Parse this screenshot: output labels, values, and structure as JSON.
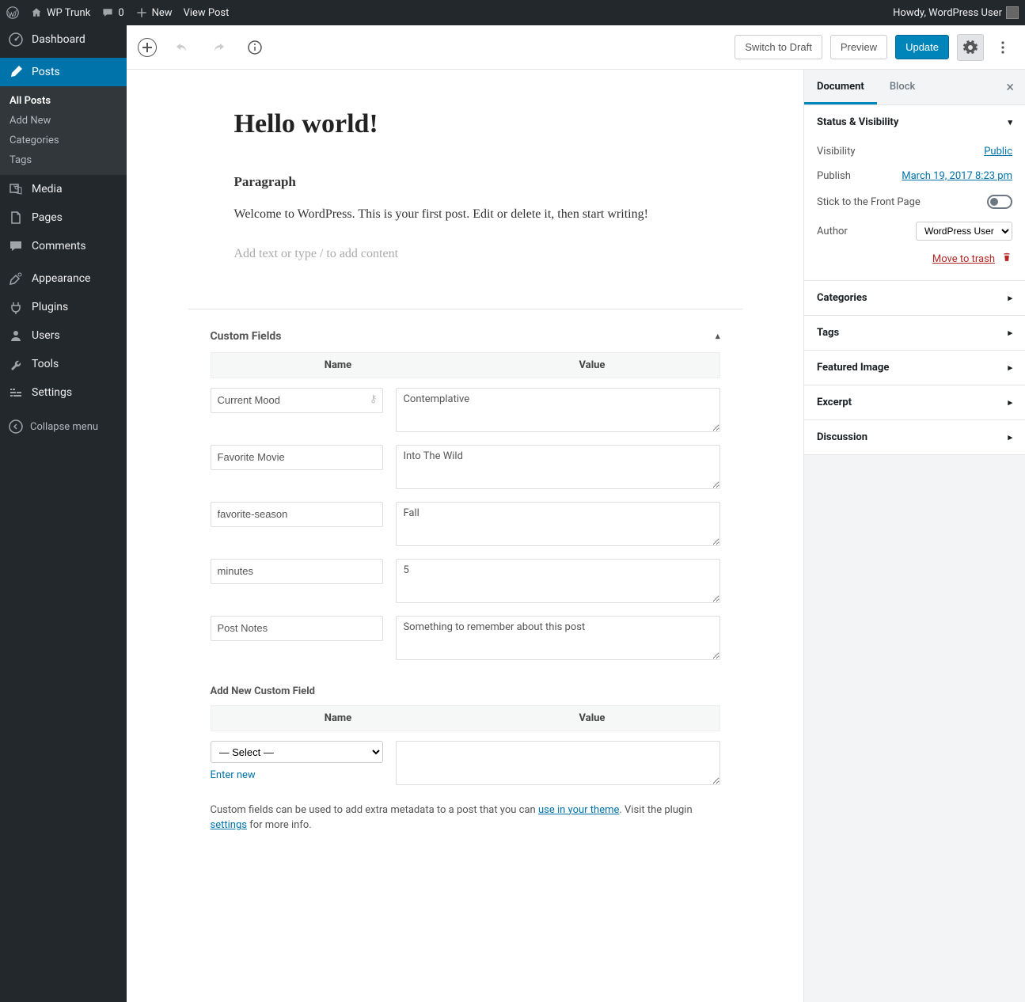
{
  "adminbar": {
    "site": "WP Trunk",
    "comments": "0",
    "new": "New",
    "view_post": "View Post",
    "howdy": "Howdy, WordPress User"
  },
  "sidebar": {
    "dashboard": "Dashboard",
    "posts": "Posts",
    "posts_sub": {
      "all": "All Posts",
      "add": "Add New",
      "categories": "Categories",
      "tags": "Tags"
    },
    "media": "Media",
    "pages": "Pages",
    "comments": "Comments",
    "appearance": "Appearance",
    "plugins": "Plugins",
    "users": "Users",
    "tools": "Tools",
    "settings": "Settings",
    "collapse": "Collapse menu"
  },
  "toolbar": {
    "switch_draft": "Switch to Draft",
    "preview": "Preview",
    "update": "Update"
  },
  "editor": {
    "title": "Hello world!",
    "heading": "Paragraph",
    "paragraph": "Welcome to WordPress. This is your first post. Edit or delete it, then start writing!",
    "placeholder": "Add text or type / to add content"
  },
  "custom_fields": {
    "panel_title": "Custom Fields",
    "col_name": "Name",
    "col_value": "Value",
    "rows": [
      {
        "name": "Current Mood",
        "value": "Contemplative",
        "has_key_icon": true
      },
      {
        "name": "Favorite Movie",
        "value": "Into The Wild"
      },
      {
        "name": "favorite-season",
        "value": "Fall"
      },
      {
        "name": "minutes",
        "value": "5"
      },
      {
        "name": "Post Notes",
        "value": "Something to remember about this post"
      }
    ],
    "add_new_title": "Add New Custom Field",
    "select_placeholder": "— Select —",
    "enter_new": "Enter new",
    "help_pre": "Custom fields can be used to add extra metadata to a post that you can ",
    "help_link1": "use in your theme",
    "help_mid": ". Visit the plugin ",
    "help_link2": "settings",
    "help_post": " for more info."
  },
  "doc_sidebar": {
    "tab_document": "Document",
    "tab_block": "Block",
    "status_title": "Status & Visibility",
    "visibility_label": "Visibility",
    "visibility_value": "Public",
    "publish_label": "Publish",
    "publish_value": "March 19, 2017 8:23 pm",
    "stick_label": "Stick to the Front Page",
    "author_label": "Author",
    "author_value": "WordPress User",
    "trash": "Move to trash",
    "categories": "Categories",
    "tags": "Tags",
    "featured": "Featured Image",
    "excerpt": "Excerpt",
    "discussion": "Discussion"
  }
}
